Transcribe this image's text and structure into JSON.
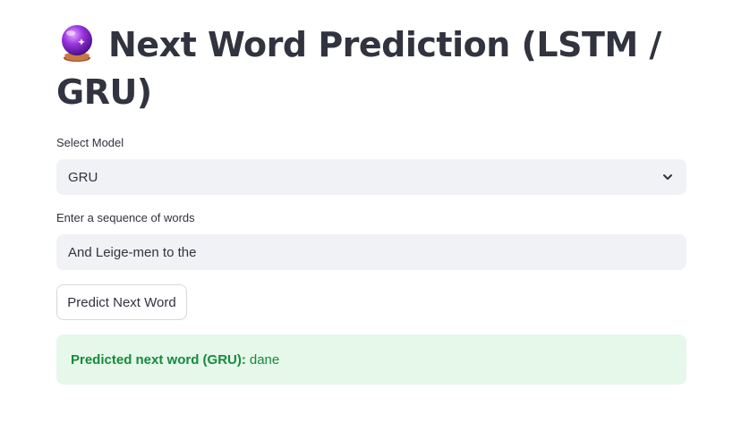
{
  "header": {
    "title": "Next Word Prediction (LSTM / GRU)",
    "icon": "crystal-ball-icon"
  },
  "model_select": {
    "label": "Select Model",
    "value": "GRU",
    "icon": "chevron-down-icon"
  },
  "sequence_input": {
    "label": "Enter a sequence of words",
    "value": "And Leige-men to the"
  },
  "predict_button": {
    "label": "Predict Next Word"
  },
  "result": {
    "prefix": "Predicted next word (GRU):",
    "word": "dane"
  },
  "colors": {
    "text": "#31333f",
    "input_bg": "#f0f2f6",
    "success_bg": "#e5f8ea",
    "success_text": "#178a3a"
  }
}
